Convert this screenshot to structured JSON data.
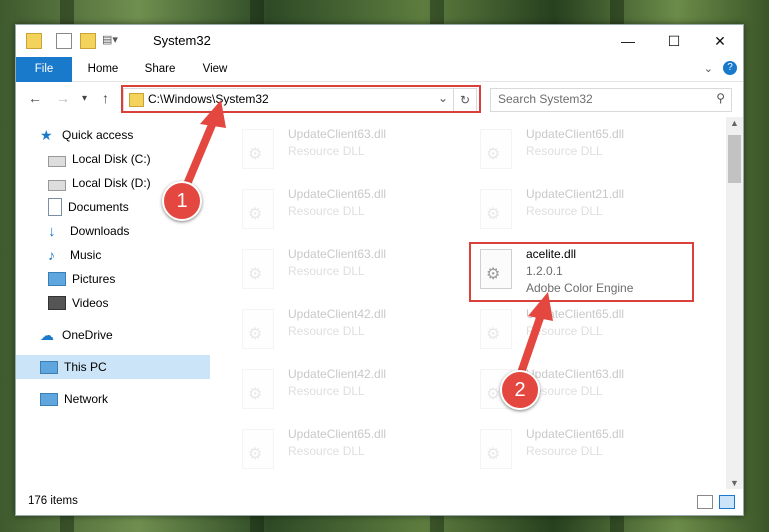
{
  "window": {
    "title": "System32"
  },
  "ribbon": {
    "tabs": [
      "File",
      "Home",
      "Share",
      "View"
    ]
  },
  "address": {
    "path": "C:\\Windows\\System32"
  },
  "search": {
    "placeholder": "Search System32"
  },
  "sidebar": {
    "items": [
      {
        "label": "Quick access",
        "icon": "star-icon",
        "pinned": false
      },
      {
        "label": "Local Disk (C:)",
        "icon": "drive-icon",
        "pinned": false
      },
      {
        "label": "Local Disk (D:)",
        "icon": "drive-icon",
        "pinned": true
      },
      {
        "label": "Documents",
        "icon": "documents-icon",
        "pinned": true
      },
      {
        "label": "Downloads",
        "icon": "download-icon",
        "pinned": true
      },
      {
        "label": "Music",
        "icon": "music-icon",
        "pinned": true
      },
      {
        "label": "Pictures",
        "icon": "pictures-icon",
        "pinned": true
      },
      {
        "label": "Videos",
        "icon": "videos-icon",
        "pinned": true
      },
      {
        "label": "OneDrive",
        "icon": "cloud-icon",
        "pinned": false
      },
      {
        "label": "This PC",
        "icon": "computer-icon",
        "pinned": false,
        "selected": true
      },
      {
        "label": "Network",
        "icon": "network-icon",
        "pinned": false
      }
    ]
  },
  "files": {
    "left": [
      {
        "name": "UpdateClient63.dll",
        "type": "Resource DLL"
      },
      {
        "name": "UpdateClient65.dll",
        "type": "Resource DLL"
      },
      {
        "name": "UpdateClient63.dll",
        "type": "Resource DLL"
      },
      {
        "name": "UpdateClient42.dll",
        "type": "Resource DLL"
      },
      {
        "name": "UpdateClient42.dll",
        "type": "Resource DLL"
      },
      {
        "name": "UpdateClient65.dll",
        "type": "Resource DLL"
      }
    ],
    "right": [
      {
        "name": "UpdateClient65.dll",
        "type": "Resource DLL"
      },
      {
        "name": "UpdateClient21.dll",
        "type": "Resource DLL"
      },
      {
        "name": "UpdateClient65.dll",
        "type": "Resource DLL"
      },
      {
        "name": "UpdateClient63.dll",
        "type": "Resource DLL"
      },
      {
        "name": "UpdateClient65.dll",
        "type": "Resource DLL"
      }
    ],
    "highlighted": {
      "name": "acelite.dll",
      "version": "1.2.0.1",
      "description": "Adobe Color Engine"
    }
  },
  "status": {
    "item_count": "176 items"
  },
  "callouts": {
    "one": "1",
    "two": "2"
  },
  "colors": {
    "accent": "#1979ca",
    "callout": "#e4473f"
  }
}
